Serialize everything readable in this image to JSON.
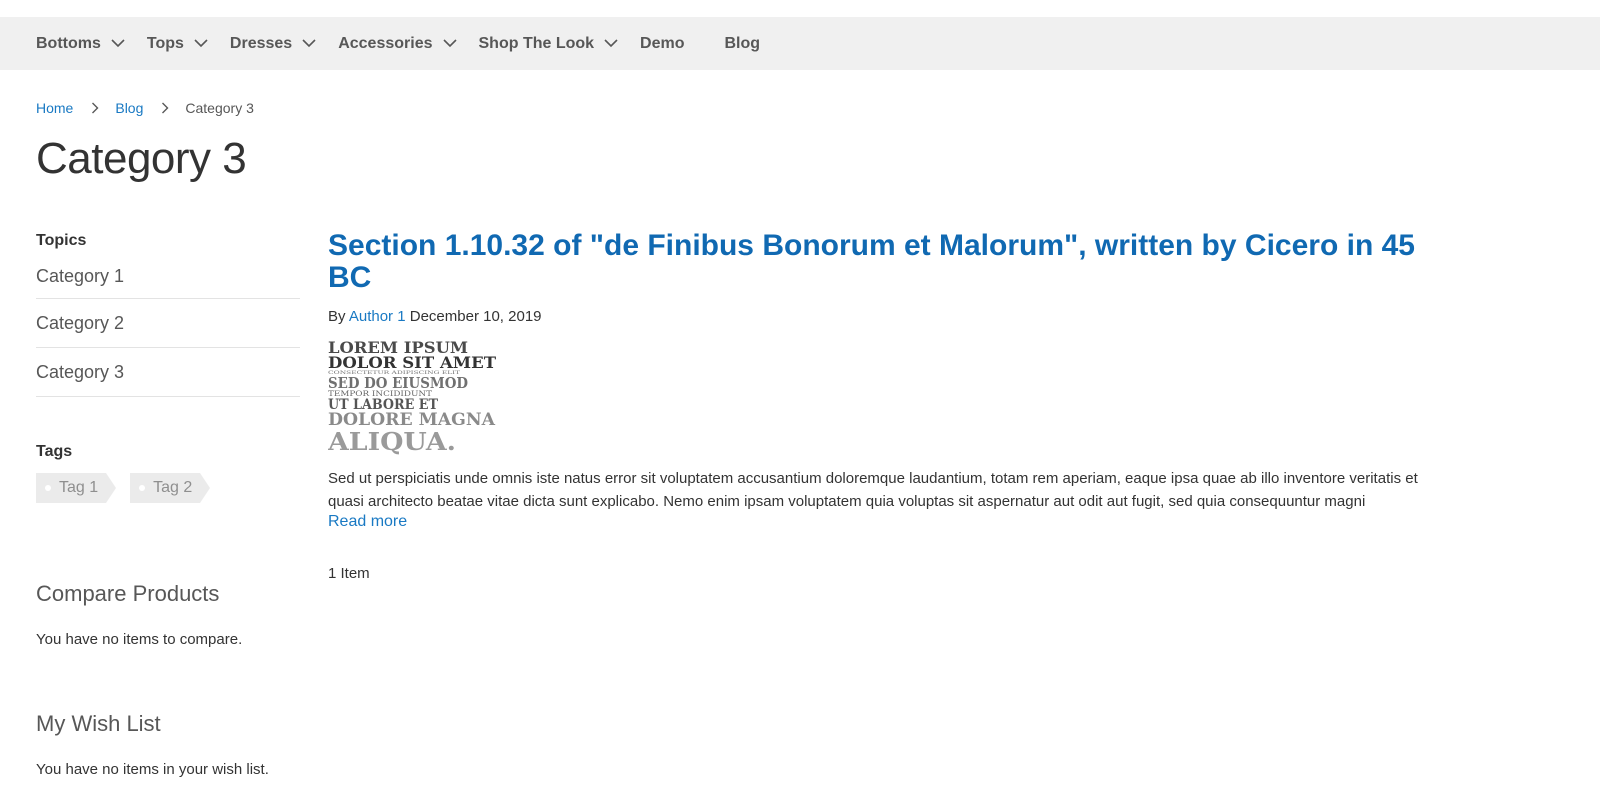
{
  "nav": {
    "items": [
      {
        "label": "Bottoms",
        "has_dropdown": true
      },
      {
        "label": "Tops",
        "has_dropdown": true
      },
      {
        "label": "Dresses",
        "has_dropdown": true
      },
      {
        "label": "Accessories",
        "has_dropdown": true
      },
      {
        "label": "Shop The Look",
        "has_dropdown": true
      },
      {
        "label": "Demo",
        "has_dropdown": false
      },
      {
        "label": "Blog",
        "has_dropdown": false
      }
    ]
  },
  "breadcrumb": {
    "home": "Home",
    "blog": "Blog",
    "current": "Category 3"
  },
  "page": {
    "title": "Category 3"
  },
  "sidebar": {
    "topics_title": "Topics",
    "topics": [
      "Category 1",
      "Category 2",
      "Category 3"
    ],
    "tags_title": "Tags",
    "tags": [
      "Tag 1",
      "Tag 2"
    ],
    "compare_title": "Compare Products",
    "compare_empty": "You have no items to compare.",
    "wishlist_title": "My Wish List",
    "wishlist_empty": "You have no items in your wish list."
  },
  "post": {
    "title": "Section 1.10.32 of \"de Finibus Bonorum et Malorum\", written by Cicero in 45 BC",
    "by": "By",
    "author": "Author 1",
    "date": "December 10, 2019",
    "image_lines": [
      "LOREM IPSUM",
      "DOLOR SIT AMET",
      "CONSECTETUR ADIPISCING ELIT",
      "SED DO EIUSMOD",
      "TEMPOR INCIDIDUNT",
      "UT LABORE ET",
      "DOLORE MAGNA",
      "ALIQUA."
    ],
    "excerpt": "Sed ut perspiciatis unde omnis iste natus error sit voluptatem accusantium doloremque laudantium, totam rem aperiam, eaque ipsa quae ab illo inventore veritatis et quasi architecto beatae vitae dicta sunt explicabo. Nemo enim ipsam voluptatem quia voluptas sit aspernatur aut odit aut fugit, sed quia consequuntur magni",
    "read_more": "Read more"
  },
  "pager": {
    "count": "1 Item"
  },
  "colors": {
    "link": "#1979c3",
    "title_link": "#1069b2",
    "nav_bg": "#f0f0f0"
  }
}
